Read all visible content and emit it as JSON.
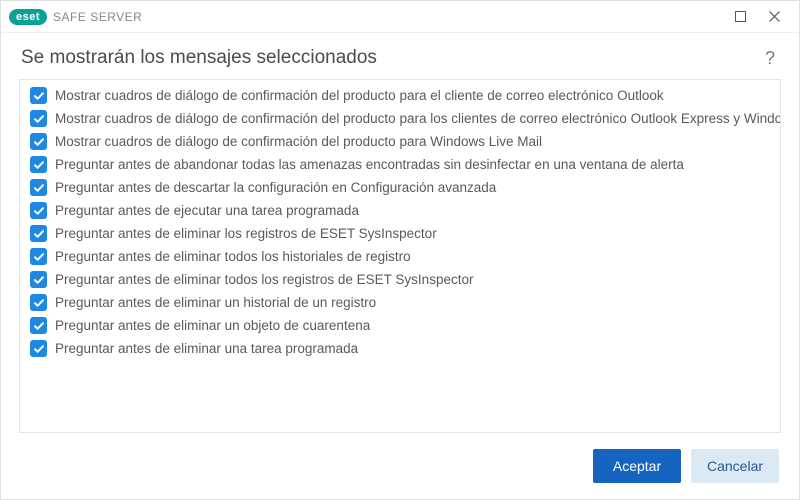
{
  "brand": {
    "badge": "eset",
    "product": "SAFE SERVER"
  },
  "header": {
    "title": "Se mostrarán los mensajes seleccionados",
    "help": "?"
  },
  "list": {
    "items": [
      {
        "checked": true,
        "label": "Mostrar cuadros de diálogo de confirmación del producto para el cliente de correo electrónico Outlook"
      },
      {
        "checked": true,
        "label": "Mostrar cuadros de diálogo de confirmación del producto para los clientes de correo electrónico Outlook Express y Windows Mail"
      },
      {
        "checked": true,
        "label": "Mostrar cuadros de diálogo de confirmación del producto para Windows Live Mail"
      },
      {
        "checked": true,
        "label": "Preguntar antes de abandonar todas las amenazas encontradas sin desinfectar en una ventana de alerta"
      },
      {
        "checked": true,
        "label": "Preguntar antes de descartar la configuración en Configuración avanzada"
      },
      {
        "checked": true,
        "label": "Preguntar antes de ejecutar una tarea programada"
      },
      {
        "checked": true,
        "label": "Preguntar antes de eliminar los registros de ESET SysInspector"
      },
      {
        "checked": true,
        "label": "Preguntar antes de eliminar todos los historiales de registro"
      },
      {
        "checked": true,
        "label": "Preguntar antes de eliminar todos los registros de ESET SysInspector"
      },
      {
        "checked": true,
        "label": "Preguntar antes de eliminar un historial de un registro"
      },
      {
        "checked": true,
        "label": "Preguntar antes de eliminar un objeto de cuarentena"
      },
      {
        "checked": true,
        "label": "Preguntar antes de eliminar una tarea programada"
      }
    ]
  },
  "footer": {
    "ok": "Aceptar",
    "cancel": "Cancelar"
  }
}
